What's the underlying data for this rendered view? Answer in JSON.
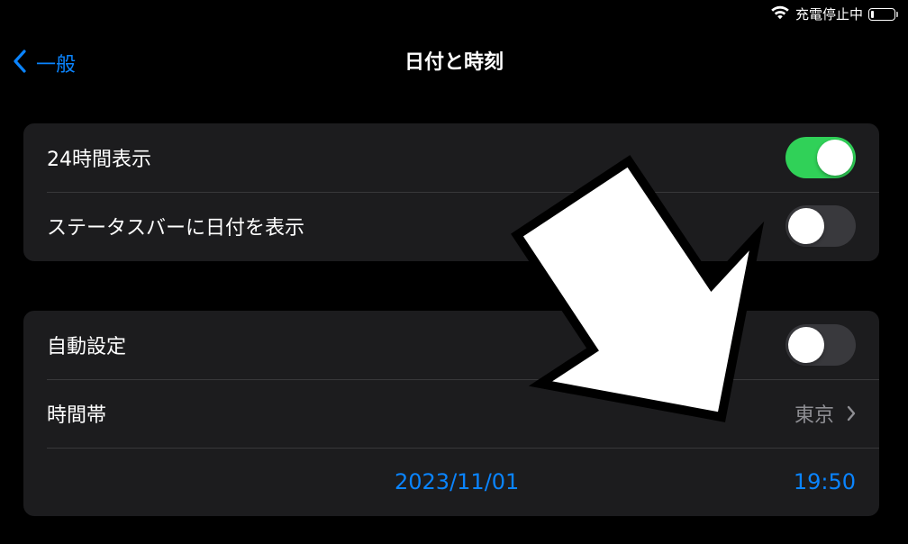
{
  "status_bar": {
    "charging_text": "充電停止中",
    "wifi_icon": "wifi-icon",
    "battery_icon": "battery-icon",
    "battery_level": 0.12
  },
  "nav": {
    "back_label": "一般",
    "title": "日付と時刻"
  },
  "group1": {
    "row_24h": {
      "label": "24時間表示",
      "on": true
    },
    "row_statusbar_date": {
      "label": "ステータスバーに日付を表示",
      "on": false
    }
  },
  "group2": {
    "row_auto": {
      "label": "自動設定",
      "on": false
    },
    "row_timezone": {
      "label": "時間帯",
      "value": "東京"
    },
    "date": "2023/11/01",
    "time": "19:50"
  },
  "colors": {
    "background": "#000000",
    "cell": "#1c1c1e",
    "separator": "#38383a",
    "accent_blue": "#0a84ff",
    "toggle_on": "#30d158",
    "toggle_off": "#39393d",
    "secondary_text": "#8e8e93"
  }
}
